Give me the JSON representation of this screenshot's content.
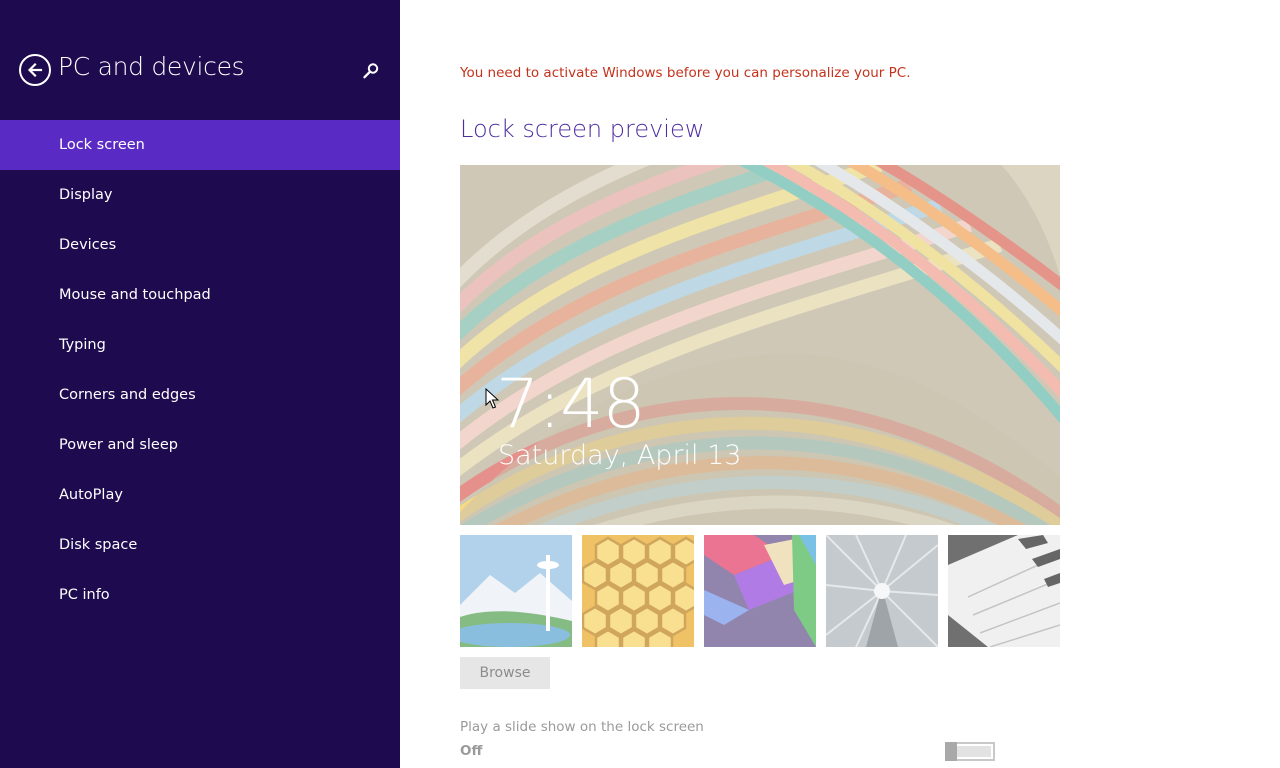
{
  "sidebar": {
    "title": "PC and devices",
    "back_icon": "back-arrow-circle-icon",
    "search_icon": "search-icon",
    "background_color": "#1e0a4e",
    "selected_color": "#5a2bc4",
    "items": [
      {
        "label": "Lock screen",
        "selected": true
      },
      {
        "label": "Display"
      },
      {
        "label": "Devices"
      },
      {
        "label": "Mouse and touchpad"
      },
      {
        "label": "Typing"
      },
      {
        "label": "Corners and edges"
      },
      {
        "label": "Power and sleep"
      },
      {
        "label": "AutoPlay"
      },
      {
        "label": "Disk space"
      },
      {
        "label": "PC info"
      }
    ]
  },
  "main": {
    "activation_warning": "You need to activate Windows before you can personalize your PC.",
    "warning_color": "#c4321c",
    "section_title": "Lock screen preview",
    "title_color": "#4d2ca0",
    "preview": {
      "time": "7:48",
      "date": "Saturday, April 13"
    },
    "thumbnails": [
      {
        "name": "space-needle-thumbnail"
      },
      {
        "name": "honeycomb-thumbnail"
      },
      {
        "name": "geometric-shapes-thumbnail"
      },
      {
        "name": "subway-motion-thumbnail"
      },
      {
        "name": "piano-keys-thumbnail"
      }
    ],
    "browse_label": "Browse",
    "slideshow": {
      "label": "Play a slide show on the lock screen",
      "state": "Off",
      "enabled": false
    }
  }
}
